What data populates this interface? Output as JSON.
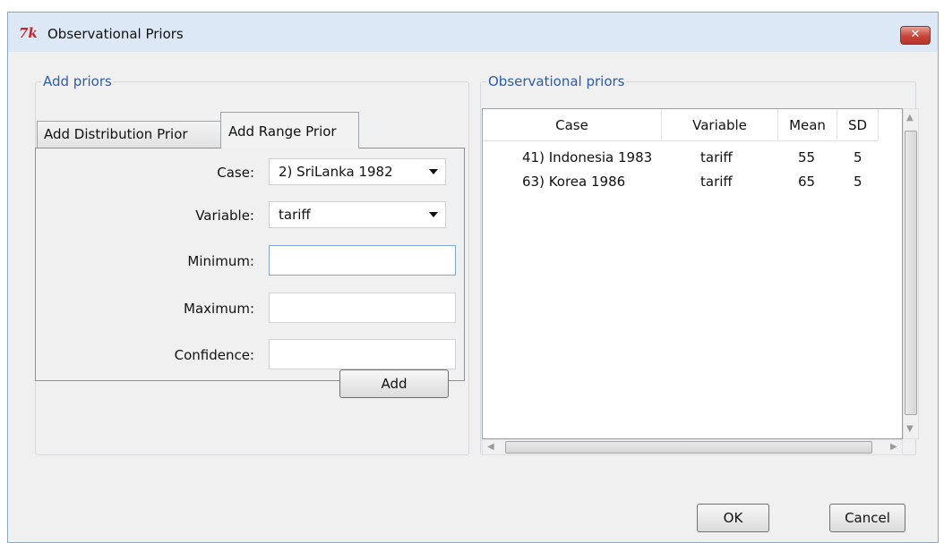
{
  "window": {
    "title": "Observational Priors",
    "logo_text": "7k",
    "close_label": "✕"
  },
  "left_group": {
    "legend": "Add priors",
    "tabs": [
      {
        "label": "Add Distribution Prior",
        "active": false
      },
      {
        "label": "Add Range Prior",
        "active": true
      }
    ],
    "form": {
      "case_label": "Case:",
      "case_value": "2) SriLanka 1982",
      "variable_label": "Variable:",
      "variable_value": "tariff",
      "minimum_label": "Minimum:",
      "minimum_value": "",
      "maximum_label": "Maximum:",
      "maximum_value": "",
      "confidence_label": "Confidence:",
      "confidence_value": ""
    },
    "add_label": "Add"
  },
  "right_group": {
    "legend": "Observational priors",
    "columns": [
      "Case",
      "Variable",
      "Mean",
      "SD"
    ],
    "rows": [
      {
        "case": "41) Indonesia 1983",
        "variable": "tariff",
        "mean": "55",
        "sd": "5"
      },
      {
        "case": "63) Korea 1986",
        "variable": "tariff",
        "mean": "65",
        "sd": "5"
      }
    ]
  },
  "buttons": {
    "ok_label": "OK",
    "cancel_label": "Cancel"
  },
  "icons": {
    "logo": "tk-logo-icon",
    "close": "close-icon",
    "dropdown": "chevron-down-icon"
  },
  "colors": {
    "legend": "#2d5ca8",
    "close_button": "#c8453a",
    "window_frame": "#dce8f5"
  }
}
